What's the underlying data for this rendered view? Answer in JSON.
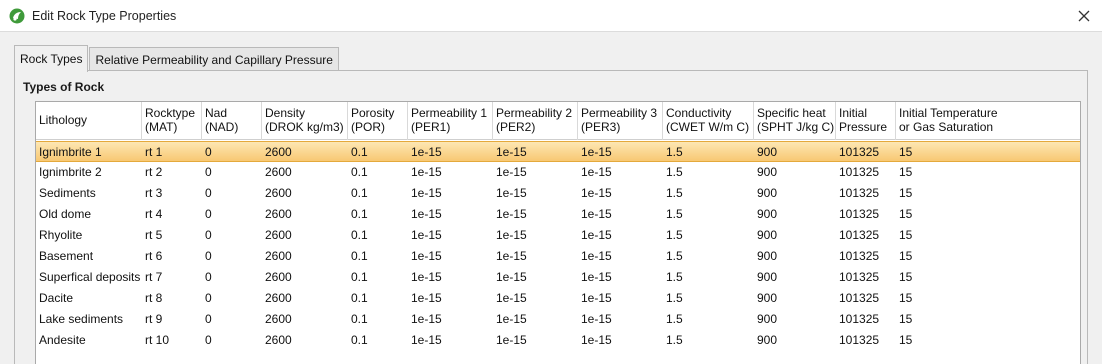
{
  "window": {
    "title": "Edit Rock Type Properties"
  },
  "tabs": [
    {
      "label": "Rock Types",
      "active": true
    },
    {
      "label": "Relative Permeability and Capillary Pressure",
      "active": false
    }
  ],
  "group": {
    "title": "Types of Rock"
  },
  "table": {
    "columns": [
      "Lithology",
      "Rocktype\n(MAT)",
      "Nad\n(NAD)",
      "Density\n(DROK kg/m3)",
      "Porosity\n(POR)",
      "Permeability 1\n(PER1)",
      "Permeability 2\n(PER2)",
      "Permeability 3\n(PER3)",
      "Conductivity\n(CWET W/m C)",
      "Specific heat\n(SPHT J/kg C)",
      "Initial\nPressure",
      "Initial Temperature\nor Gas Saturation"
    ],
    "selected_row": 0,
    "rows": [
      [
        "Ignimbrite 1",
        "rt  1",
        "0",
        "2600",
        "0.1",
        "1e-15",
        "1e-15",
        "1e-15",
        "1.5",
        "900",
        "101325",
        "15"
      ],
      [
        "Ignimbrite 2",
        "rt  2",
        "0",
        "2600",
        "0.1",
        "1e-15",
        "1e-15",
        "1e-15",
        "1.5",
        "900",
        "101325",
        "15"
      ],
      [
        "Sediments",
        "rt  3",
        "0",
        "2600",
        "0.1",
        "1e-15",
        "1e-15",
        "1e-15",
        "1.5",
        "900",
        "101325",
        "15"
      ],
      [
        "Old dome",
        "rt  4",
        "0",
        "2600",
        "0.1",
        "1e-15",
        "1e-15",
        "1e-15",
        "1.5",
        "900",
        "101325",
        "15"
      ],
      [
        "Rhyolite",
        "rt  5",
        "0",
        "2600",
        "0.1",
        "1e-15",
        "1e-15",
        "1e-15",
        "1.5",
        "900",
        "101325",
        "15"
      ],
      [
        "Basement",
        "rt  6",
        "0",
        "2600",
        "0.1",
        "1e-15",
        "1e-15",
        "1e-15",
        "1.5",
        "900",
        "101325",
        "15"
      ],
      [
        "Superfical deposits",
        "rt  7",
        "0",
        "2600",
        "0.1",
        "1e-15",
        "1e-15",
        "1e-15",
        "1.5",
        "900",
        "101325",
        "15"
      ],
      [
        "Dacite",
        "rt  8",
        "0",
        "2600",
        "0.1",
        "1e-15",
        "1e-15",
        "1e-15",
        "1.5",
        "900",
        "101325",
        "15"
      ],
      [
        "Lake sediments",
        "rt  9",
        "0",
        "2600",
        "0.1",
        "1e-15",
        "1e-15",
        "1e-15",
        "1.5",
        "900",
        "101325",
        "15"
      ],
      [
        "Andesite",
        "rt 10",
        "0",
        "2600",
        "0.1",
        "1e-15",
        "1e-15",
        "1e-15",
        "1.5",
        "900",
        "101325",
        "15"
      ]
    ]
  },
  "icons": {
    "app": "leapfrog-app-icon",
    "close": "close-icon"
  },
  "colors": {
    "selection_top": "#fde7b3",
    "selection_bottom": "#f8c873",
    "selection_border": "#e4a93c",
    "app_icon_green": "#3f9a3a"
  }
}
